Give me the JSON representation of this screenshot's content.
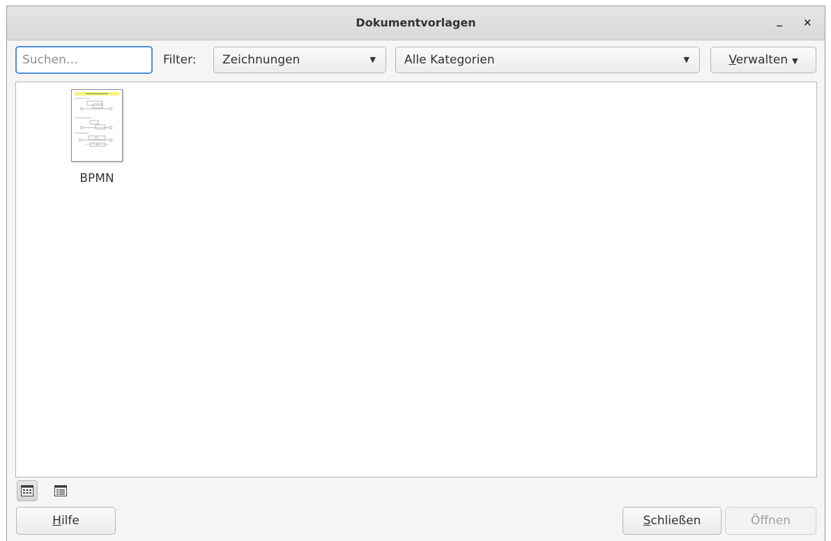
{
  "window": {
    "title": "Dokumentvorlagen",
    "minimize_glyph": "_",
    "close_glyph": "×"
  },
  "toolbar": {
    "search_placeholder": "Suchen…",
    "filter_label": "Filter:",
    "filter_value": "Zeichnungen",
    "category_value": "Alle Kategorien",
    "manage_label_mnemonic": "V",
    "manage_label_rest": "erwalten"
  },
  "templates": [
    {
      "name": "BPMN",
      "thumbnail_icon": "drawing-thumbnail"
    }
  ],
  "view_modes": [
    {
      "name": "thumbnail-view-icon",
      "active": true
    },
    {
      "name": "list-view-icon",
      "active": false
    }
  ],
  "buttons": {
    "help_mnemonic": "H",
    "help_rest": "ilfe",
    "close_mnemonic": "S",
    "close_rest": "chließen",
    "open_label": "Öffnen"
  },
  "colors": {
    "focus_accent": "#4a90d9",
    "thumbnail_header": "#f4f57a"
  }
}
